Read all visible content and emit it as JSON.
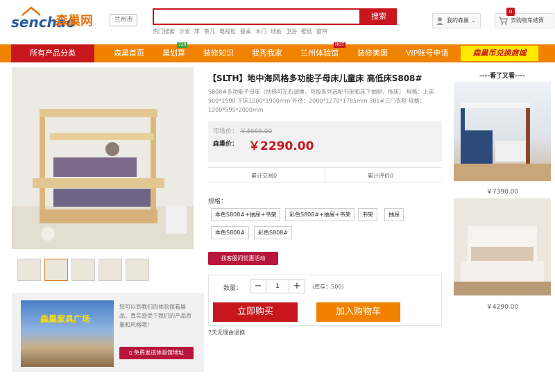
{
  "header": {
    "logo_en": "senchao",
    "logo_cn": "森巢网",
    "city": "兰州市",
    "search_placeholder": "",
    "search_btn": "搜索",
    "hot_label": "热门搜索",
    "hot_items": [
      "沙发",
      "床",
      "茶几",
      "电视柜",
      "餐桌",
      "木门",
      "地板",
      "卫浴",
      "壁纸",
      "窗帘"
    ],
    "my_senchao": "我的森巢",
    "cart_label": "去购物车结算",
    "cart_count": "0"
  },
  "nav": {
    "all": "所有产品分类",
    "items": [
      "森巢首页",
      "巢划算",
      "装修知识",
      "我秀我家",
      "兰州体验馆",
      "装修美图",
      "VIP账号申请"
    ],
    "tag_720": "720",
    "tag_hot": "HOT",
    "exchange": "森巢币兑换商城"
  },
  "product": {
    "title": "【SLTH】地中海风格多功能子母床儿童床 高低床S808#",
    "desc": "S808#多功能子母床（扶梯可左右调换，可按系列选配书架和床下抽屉、拖床） 规格：上床900*1900 下床1200*1900mm 外径：2000*1270*1785mm 301#三门衣柜 规格：1200*595*2000mm",
    "market_label": "市场价：",
    "market_price": "￥4669.00",
    "sale_label": "森巢价：",
    "sale_price": "￥2290.00",
    "trades": "累计交易0",
    "reviews": "累计评价0",
    "spec_label": "规格：",
    "specs": [
      "本色S808#+抽屉+书架",
      "彩色S808#+抽屉+书架",
      "书架",
      "抽屉",
      "本色S808#",
      "彩色S808#"
    ],
    "deal_btn": "找客服问优惠活动",
    "qty_label": "数量：",
    "qty": "1",
    "stock": "(库存：500)",
    "buy_now": "立即购买",
    "add_cart": "加入购物车",
    "return_policy": "7天无理由退换"
  },
  "promo": {
    "text": "您可以到我们的体验馆看展品，真实感受下我们的产品质量和风格哦！",
    "btn": "免费发送体验馆地址",
    "banner": "森巢家具广场"
  },
  "sidebar": {
    "title": "----看了又看----",
    "items": [
      {
        "price": "￥7390.00"
      },
      {
        "price": "￥4290.00"
      }
    ]
  }
}
